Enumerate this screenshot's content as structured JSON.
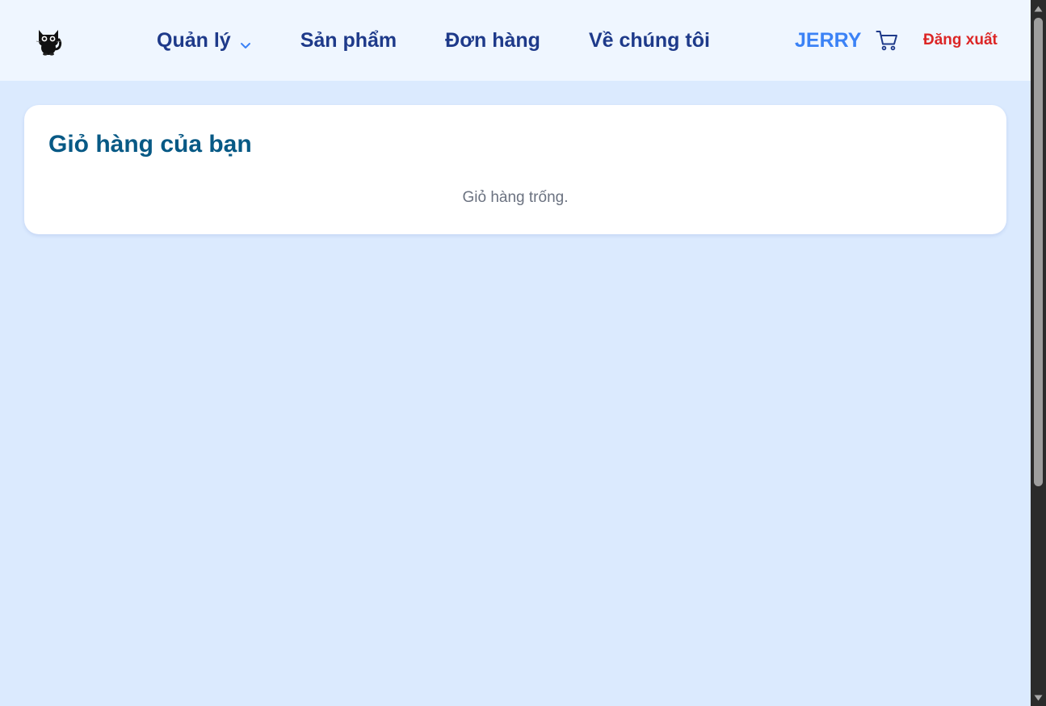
{
  "navbar": {
    "logo_icon": "black-cat-logo-icon",
    "items": [
      {
        "label": "Quản lý",
        "has_dropdown": true,
        "icon": "chevron-down-icon"
      },
      {
        "label": "Sản phẩm"
      },
      {
        "label": "Đơn hàng"
      },
      {
        "label": "Về chúng tôi"
      }
    ],
    "user_name": "JERRY",
    "cart_icon": "shopping-cart-icon",
    "logout_label": "Đăng xuất"
  },
  "cart": {
    "title": "Giỏ hàng của bạn",
    "empty_message": "Giỏ hàng trống."
  },
  "colors": {
    "page_background": "#dbeafe",
    "navbar_background": "#eff6ff",
    "nav_text": "#1e3a8a",
    "user_name": "#3b82f6",
    "logout": "#dc2626",
    "card_title": "#075985",
    "muted_text": "#6b7280",
    "chevron": "#3b82f6"
  }
}
